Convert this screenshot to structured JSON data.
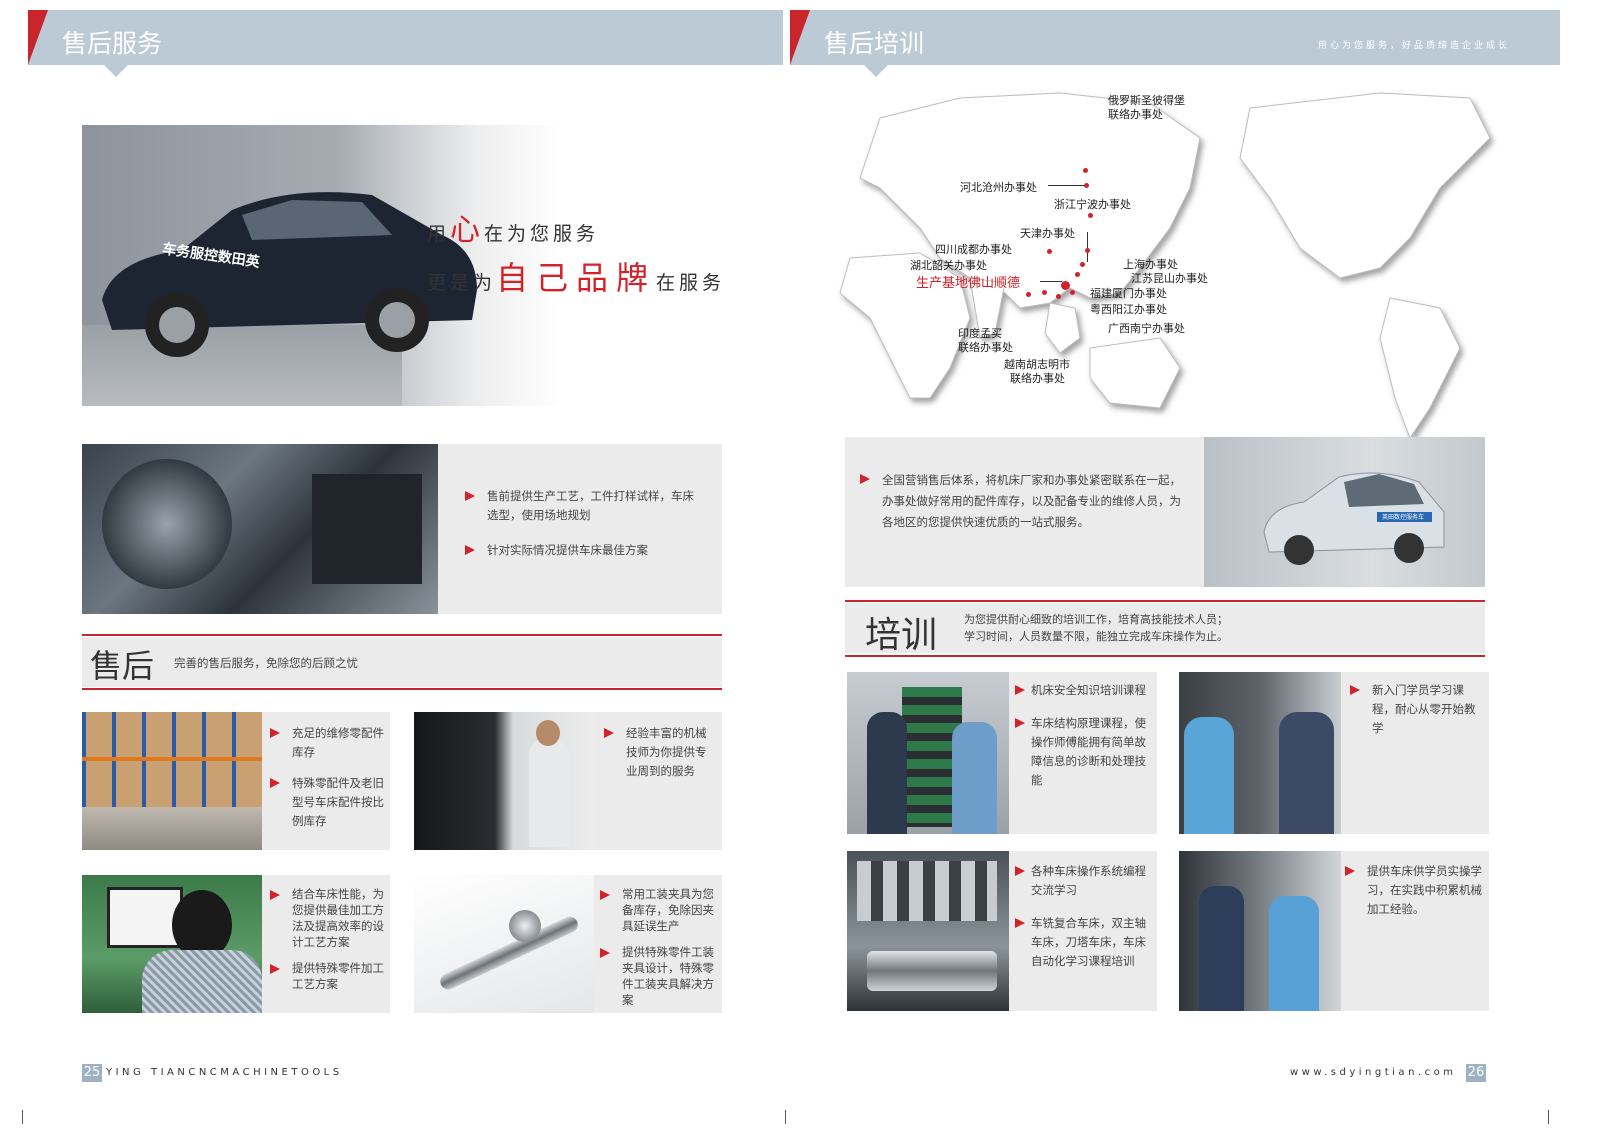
{
  "left_page": {
    "banner_title": "售后服务",
    "hero_line1_pre": "用",
    "hero_line1_emph": "心",
    "hero_line1_post": "在为您服务",
    "hero_line2_pre": "更是为",
    "hero_line2_emph": "自己品牌",
    "hero_line2_post": "在服务",
    "car_side_text": "车务服控数田英",
    "presale_bullets": [
      "售前提供生产工艺，工件打样试样，车床选型，使用场地规划",
      "针对实际情况提供车床最佳方案"
    ],
    "aftersale_heading": "售后",
    "aftersale_subtitle": "完善的售后服务，免除您的后顾之忧",
    "card1_bullets": [
      "充足的维修零配件库存",
      "特殊零配件及老旧型号车床配件按比例库存"
    ],
    "card2_bullets": [
      "经验丰富的机械技师为你提供专业周到的服务"
    ],
    "card3_bullets": [
      "结合车床性能，为您提供最佳加工方法及提高效率的设计工艺方案",
      "提供特殊零件加工工艺方案"
    ],
    "card4_bullets": [
      "常用工装夹具为您备库存，免除因夹具延误生产",
      "提供特殊零件工装夹具设计，特殊零件工装夹具解决方案"
    ],
    "footer_page_number": "25",
    "footer_text": "YING TIANCNCMACHINETOOLS"
  },
  "right_page": {
    "banner_title": "售后培训",
    "slogan": "用心为您服务，好品质缔造企业成长",
    "map_labels": {
      "russia_line1": "俄罗斯圣彼得堡",
      "russia_line2": "联络办事处",
      "hebei": "河北沧州办事处",
      "zhejiang": "浙江宁波办事处",
      "tianjin": "天津办事处",
      "sichuan": "四川成都办事处",
      "hubei": "湖北韶关办事处",
      "base": "生产基地佛山顺德",
      "shanghai": "上海办事处",
      "jiangsu": "江苏昆山办事处",
      "fujian": "福建厦门办事处",
      "guangdong": "粤西阳江办事处",
      "guangxi": "广西南宁办事处",
      "india_line1": "印度孟买",
      "india_line2": "联络办事处",
      "vietnam_line1": "越南胡志明市",
      "vietnam_line2": "联络办事处"
    },
    "network_text": "全国营销售后体系，将机床厂家和办事处紧密联系在一起，办事处做好常用的配件库存，以及配备专业的维修人员，为各地区的您提供快速优质的一站式服务。",
    "car_plate_text": "英田数控服务车",
    "training_heading": "培训",
    "training_sub_line1": "为您提供耐心细致的培训工作，培育高技能技术人员；",
    "training_sub_line2": "学习时间，人员数量不限，能独立完成车床操作为止。",
    "tcard1_bullets": [
      "机床安全知识培训课程",
      "车床结构原理课程，使操作师傅能拥有简单故障信息的诊断和处理技能"
    ],
    "tcard2_bullets": [
      "新入门学员学习课程，耐心从零开始教学"
    ],
    "tcard3_bullets": [
      "各种车床操作系统编程交流学习",
      "车铣复合车床，双主轴车床，刀塔车床，车床自动化学习课程培训"
    ],
    "tcard4_bullets": [
      "提供车床供学员实操学习，在实践中积累机械加工经验。"
    ],
    "footer_url": "www.sdyingtian.com",
    "footer_page_number": "26"
  },
  "colors": {
    "accent_red": "#c8262c",
    "banner_blue": "#bccad6",
    "panel_grey": "#ebebec"
  }
}
